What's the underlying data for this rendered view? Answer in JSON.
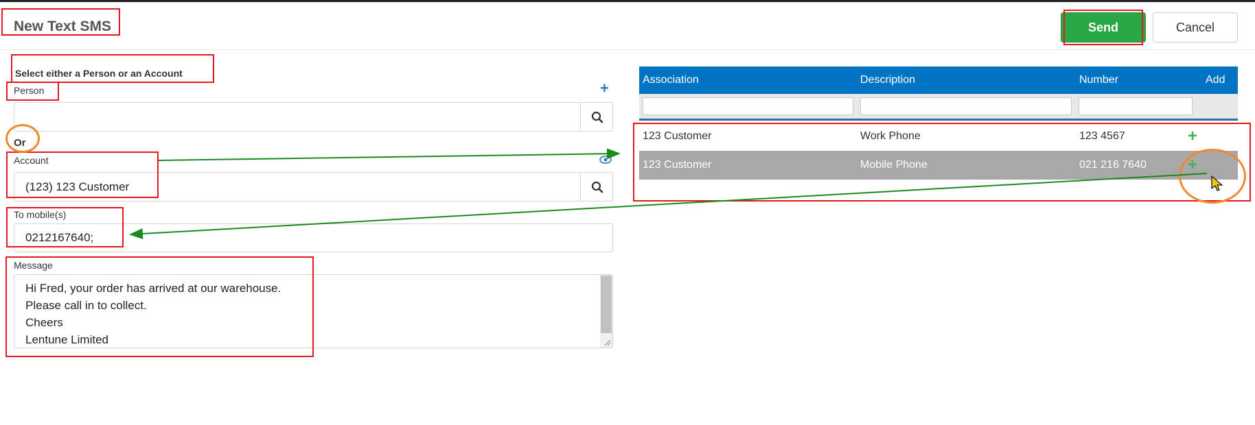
{
  "dialog": {
    "title": "New Text SMS",
    "send_label": "Send",
    "cancel_label": "Cancel"
  },
  "form": {
    "section_label": "Select either a Person or an Account",
    "person_label": "Person",
    "person_value": "",
    "or_label": "Or",
    "account_label": "Account",
    "account_value": "(123) 123 Customer",
    "to_mobile_label": "To mobile(s)",
    "to_mobile_value": "0212167640;",
    "message_label": "Message",
    "message_lines": [
      "Hi Fred, your order has arrived at our warehouse.",
      "Please call in to collect.",
      "Cheers",
      "Lentune Limited"
    ]
  },
  "table": {
    "headers": [
      "Association",
      "Description",
      "Number",
      "Add"
    ],
    "rows": [
      {
        "association": "123 Customer",
        "description": "Work Phone",
        "number": "123 4567",
        "selected": false
      },
      {
        "association": "123 Customer",
        "description": "Mobile Phone",
        "number": "021 216 7640",
        "selected": true
      }
    ]
  },
  "icons": {
    "search": "search-icon",
    "add_person": "plus-icon",
    "view_account": "eye-icon",
    "add_row": "plus-icon",
    "pointer": "cursor-icon"
  },
  "colors": {
    "send_button": "#28a745",
    "table_header": "#0074c2",
    "selected_row": "#a8a8a8",
    "add_icon": "#4cae4c",
    "annotation_red": "#e8161e",
    "annotation_orange": "#f0892b",
    "annotation_arrow": "#1a8a1a"
  }
}
